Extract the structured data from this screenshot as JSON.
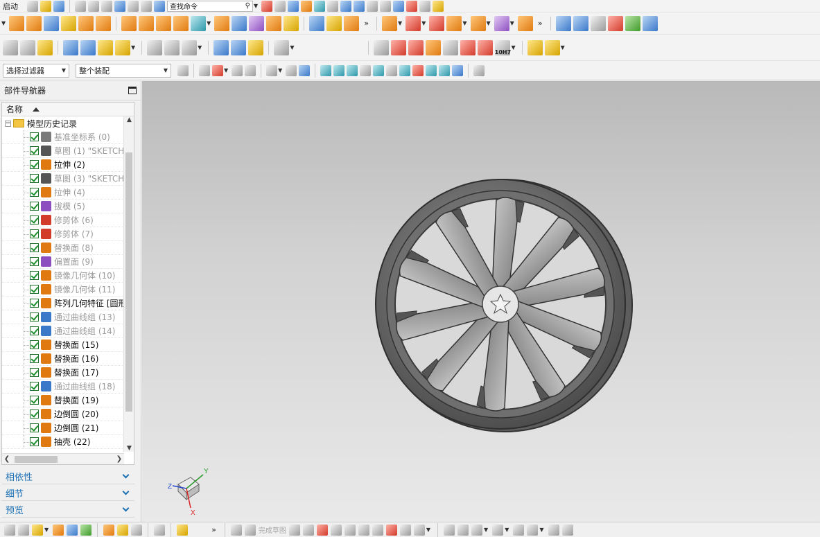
{
  "toolbar": {
    "start_label": "启动",
    "command_search_placeholder": "查找命令",
    "selection_filter": "选择过滤器",
    "assembly_scope": "整个装配",
    "tolerance_label": "10H7",
    "overflow_label": "»"
  },
  "navigator": {
    "title": "部件导航器",
    "column_name": "名称",
    "root_label": "模型历史记录",
    "features": [
      {
        "label": "基准坐标系 (0)",
        "active": false,
        "icon": "datum-csys-icon",
        "color": "#7a7a7a"
      },
      {
        "label": "草图 (1) \"SKETCH_",
        "active": false,
        "icon": "sketch-icon",
        "color": "#555555"
      },
      {
        "label": "拉伸 (2)",
        "active": true,
        "icon": "extrude-icon",
        "color": "#e07a10"
      },
      {
        "label": "草图 (3) \"SKETCH_",
        "active": false,
        "icon": "sketch-icon",
        "color": "#555555"
      },
      {
        "label": "拉伸 (4)",
        "active": false,
        "icon": "extrude-icon",
        "color": "#e07a10"
      },
      {
        "label": "拔模 (5)",
        "active": false,
        "icon": "draft-icon",
        "color": "#8d4fc0"
      },
      {
        "label": "修剪体 (6)",
        "active": false,
        "icon": "trim-body-icon",
        "color": "#d23a2a"
      },
      {
        "label": "修剪体 (7)",
        "active": false,
        "icon": "trim-body-icon",
        "color": "#d23a2a"
      },
      {
        "label": "替换面 (8)",
        "active": false,
        "icon": "replace-face-icon",
        "color": "#e07a10"
      },
      {
        "label": "偏置面 (9)",
        "active": false,
        "icon": "offset-face-icon",
        "color": "#8d4fc0"
      },
      {
        "label": "镜像几何体 (10)",
        "active": false,
        "icon": "mirror-geometry-icon",
        "color": "#e07a10"
      },
      {
        "label": "镜像几何体 (11)",
        "active": false,
        "icon": "mirror-geometry-icon",
        "color": "#e07a10"
      },
      {
        "label": "阵列几何特征 [圆形",
        "active": true,
        "icon": "pattern-geometry-icon",
        "color": "#e07a10"
      },
      {
        "label": "通过曲线组 (13)",
        "active": false,
        "icon": "through-curves-icon",
        "color": "#3a78c9"
      },
      {
        "label": "通过曲线组 (14)",
        "active": false,
        "icon": "through-curves-icon",
        "color": "#3a78c9"
      },
      {
        "label": "替换面 (15)",
        "active": true,
        "icon": "replace-face-icon",
        "color": "#e07a10"
      },
      {
        "label": "替换面 (16)",
        "active": true,
        "icon": "replace-face-icon",
        "color": "#e07a10"
      },
      {
        "label": "替换面 (17)",
        "active": true,
        "icon": "replace-face-icon",
        "color": "#e07a10"
      },
      {
        "label": "通过曲线组 (18)",
        "active": false,
        "icon": "through-curves-icon",
        "color": "#3a78c9"
      },
      {
        "label": "替换面 (19)",
        "active": true,
        "icon": "replace-face-icon",
        "color": "#e07a10"
      },
      {
        "label": "边倒圆 (20)",
        "active": true,
        "icon": "edge-blend-icon",
        "color": "#e07a10"
      },
      {
        "label": "边倒圆 (21)",
        "active": true,
        "icon": "edge-blend-icon",
        "color": "#e07a10"
      },
      {
        "label": "抽壳 (22)",
        "active": true,
        "icon": "shell-icon",
        "color": "#e07a10"
      }
    ],
    "panels": [
      {
        "label": "相依性",
        "name": "dependencies-panel"
      },
      {
        "label": "细节",
        "name": "details-panel"
      },
      {
        "label": "预览",
        "name": "preview-panel"
      }
    ]
  },
  "bottombar": {
    "finish_sketch": "完成草图"
  },
  "triad": {
    "x": "X",
    "y": "Y",
    "z": "Z"
  }
}
